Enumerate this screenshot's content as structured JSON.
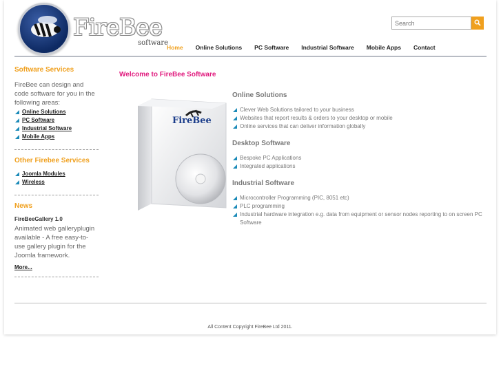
{
  "brand": {
    "name": "FireBee",
    "sub": "software"
  },
  "search": {
    "placeholder": "Search",
    "button_icon": "search-icon"
  },
  "nav": [
    {
      "label": "Home",
      "active": true
    },
    {
      "label": "Online Solutions",
      "active": false
    },
    {
      "label": "PC Software",
      "active": false
    },
    {
      "label": "Industrial Software",
      "active": false
    },
    {
      "label": "Mobile Apps",
      "active": false
    },
    {
      "label": "Contact",
      "active": false
    }
  ],
  "sidebar": {
    "services_title": "Software Services",
    "services_intro": "FireBee can design and code software for you in the following areas:",
    "services_links": [
      "Online Solutions",
      "PC Software",
      "Industrial Software",
      "Mobile Apps"
    ],
    "other_title": "Other Firebee Services",
    "other_links": [
      "Joomla Modules",
      "Wireless"
    ],
    "news_title": "News",
    "news_item_title": "FireBeeGallery 1.0",
    "news_item_body": "Animated web galleryplugin available - A free easy-to-use gallery plugin for the Joomla framework.",
    "news_more": "More..."
  },
  "main": {
    "welcome": "Welcome to FireBee Software",
    "box_label": "FireBee",
    "sections": [
      {
        "title": "Online Solutions",
        "items": [
          "Clever Web Solutions tailored to your business",
          "Websites that report results & orders to your desktop or mobile",
          "Online services that can deliver information globally"
        ]
      },
      {
        "title": "Desktop Software",
        "items": [
          "Bespoke PC Applications",
          "Integrated applications"
        ]
      },
      {
        "title": "Industrial Software",
        "items": [
          "Microcontroller Programming (PIC, 8051 etc)",
          "PLC programming",
          "Industrial hardware integration e.g. data from equipment or sensor nodes reporting to on screen PC Software"
        ]
      }
    ]
  },
  "footer": {
    "copyright": "All Content Copyright FireBee Ltd 2011."
  },
  "colors": {
    "accent": "#f0a01e",
    "welcome": "#e0197d",
    "bullet": "#1b8ab8"
  }
}
